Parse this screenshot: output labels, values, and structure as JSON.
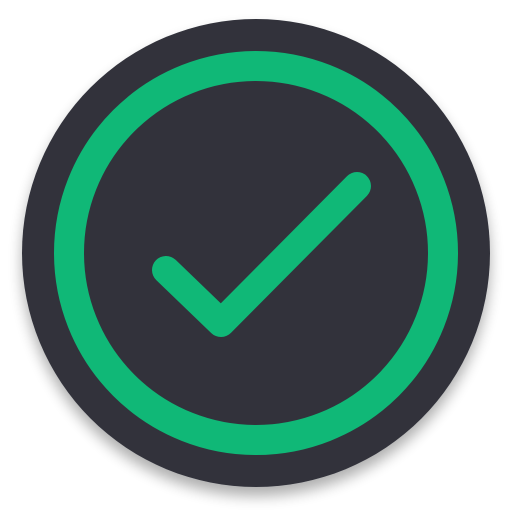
{
  "icon": {
    "name": "checkmark-badge",
    "symbol": "check-icon",
    "colors": {
      "badge_fill": "#30323b",
      "ring": "#10b877",
      "check": "#10b877",
      "shadow": "#000000"
    }
  }
}
